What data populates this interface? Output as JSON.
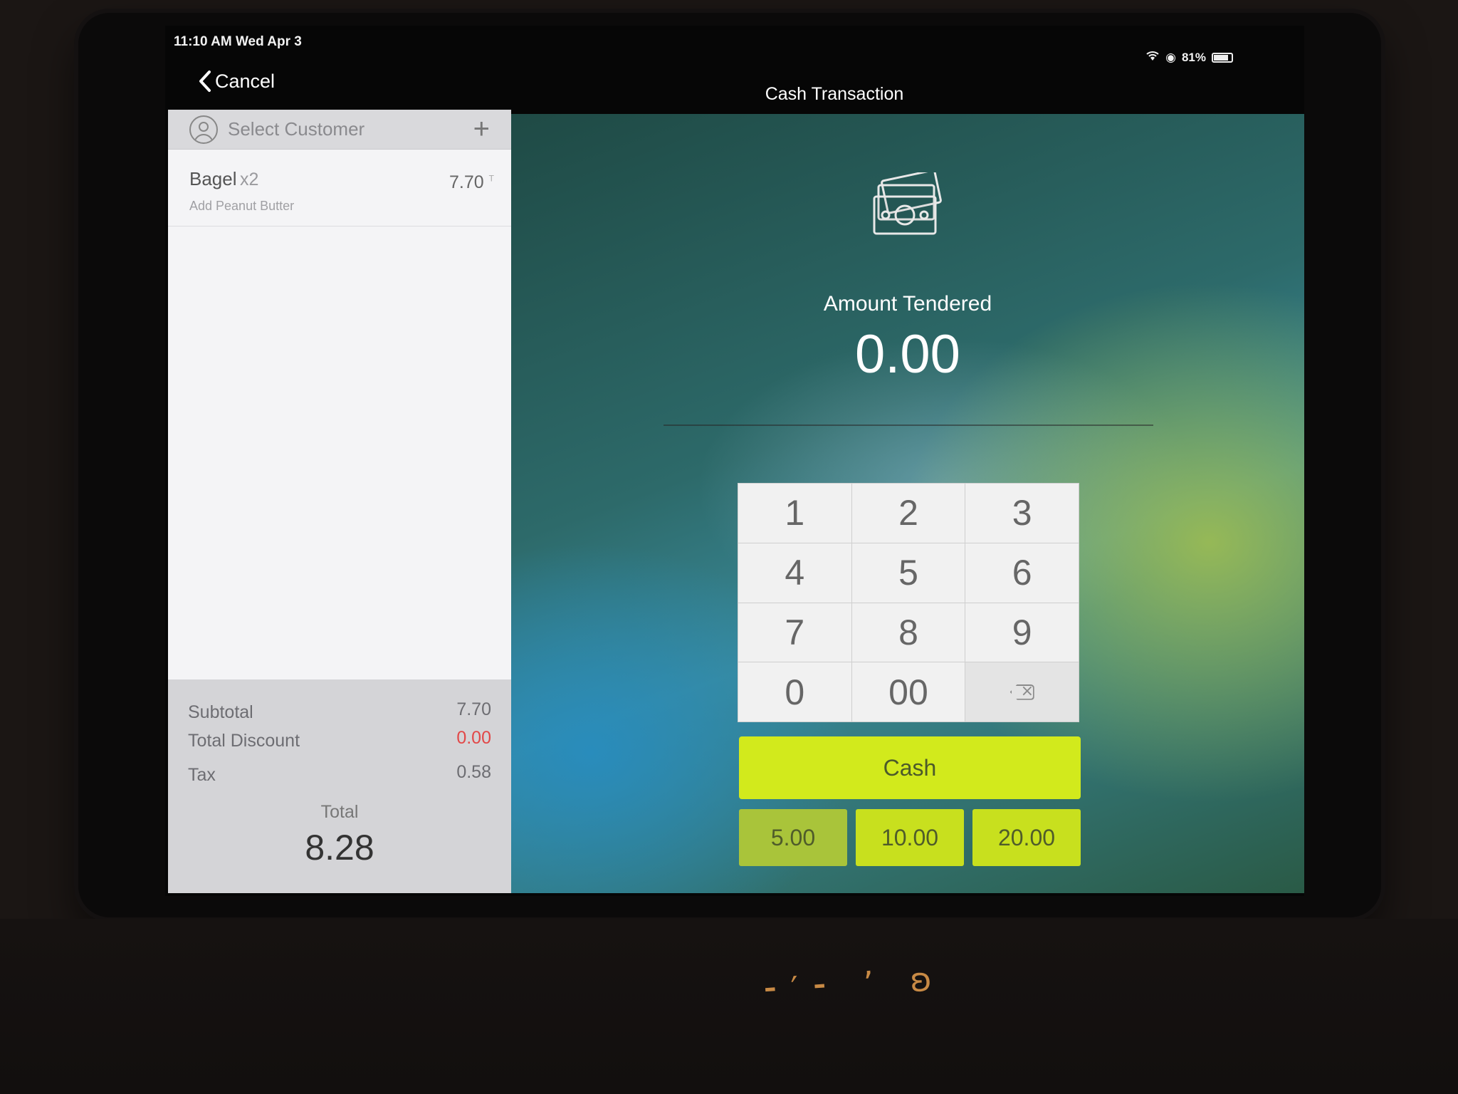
{
  "status_bar": {
    "time_date": "11:10 AM  Wed Apr 3",
    "battery": "81%"
  },
  "nav": {
    "cancel_label": "Cancel",
    "title": "Cash Transaction"
  },
  "customer": {
    "placeholder": "Select Customer",
    "add_symbol": "+"
  },
  "order": {
    "items": [
      {
        "name": "Bagel",
        "qty": "x2",
        "modifier": "Add Peanut Butter",
        "price": "7.70",
        "tax_flag": "T"
      }
    ]
  },
  "totals": {
    "subtotal_label": "Subtotal",
    "subtotal": "7.70",
    "discount_label": "Total Discount",
    "discount": "0.00",
    "tax_label": "Tax",
    "tax": "0.58",
    "total_label": "Total",
    "total": "8.28"
  },
  "payment": {
    "amount_label": "Amount Tendered",
    "amount_value": "0.00",
    "keys": [
      "1",
      "2",
      "3",
      "4",
      "5",
      "6",
      "7",
      "8",
      "9",
      "0",
      "00"
    ],
    "cash_label": "Cash",
    "quick_amounts": [
      "5.00",
      "10.00",
      "20.00"
    ]
  },
  "colors": {
    "accent_green": "#d2ea1c",
    "discount_red": "#e24848"
  },
  "icons": [
    "chevron-left-icon",
    "wifi-icon",
    "battery-icon",
    "person-icon",
    "plus-icon",
    "cash-bills-icon",
    "backspace-icon"
  ]
}
